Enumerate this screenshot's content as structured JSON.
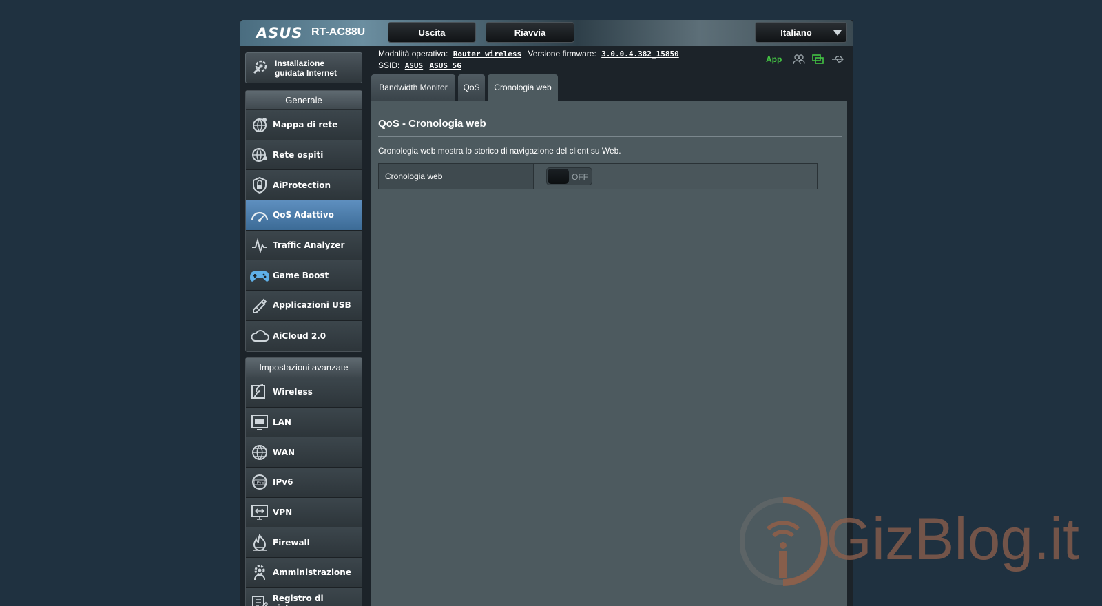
{
  "header": {
    "brand": "ASUS",
    "model": "RT-AC88U",
    "buttons": {
      "logout": "Uscita",
      "reboot": "Riavvia"
    },
    "language": "Italiano",
    "op_mode_label": "Modalità operativa:",
    "op_mode_value": "Router wireless",
    "fw_label": "Versione firmware:",
    "fw_value": "3.0.0.4.382_15850",
    "ssid_label": "SSID:",
    "ssid_1": "ASUS",
    "ssid_2": "ASUS_5G",
    "app_label": "App"
  },
  "sidebar": {
    "qis_label_1": "Installazione",
    "qis_label_2": "guidata Internet",
    "general_title": "Generale",
    "general_items": [
      {
        "label": "Mappa di rete",
        "icon": "network-map-icon"
      },
      {
        "label": "Rete ospiti",
        "icon": "guest-network-icon"
      },
      {
        "label": "AiProtection",
        "icon": "aiprotection-icon"
      },
      {
        "label": "QoS Adattivo",
        "icon": "qos-gauge-icon",
        "active": true
      },
      {
        "label": "Traffic Analyzer",
        "icon": "traffic-analyzer-icon"
      },
      {
        "label": "Game Boost",
        "icon": "gamepad-icon"
      },
      {
        "label": "Applicazioni USB",
        "icon": "usb-apps-icon"
      },
      {
        "label": "AiCloud 2.0",
        "icon": "cloud-icon"
      }
    ],
    "advanced_title": "Impostazioni avanzate",
    "advanced_items": [
      {
        "label": "Wireless",
        "icon": "wireless-icon"
      },
      {
        "label": "LAN",
        "icon": "lan-icon"
      },
      {
        "label": "WAN",
        "icon": "wan-globe-icon"
      },
      {
        "label": "IPv6",
        "icon": "ipv6-icon"
      },
      {
        "label": "VPN",
        "icon": "vpn-icon"
      },
      {
        "label": "Firewall",
        "icon": "firewall-icon"
      },
      {
        "label": "Amministrazione",
        "icon": "admin-gear-icon"
      },
      {
        "label": "Registro di sistema",
        "icon": "system-log-icon"
      }
    ]
  },
  "tabs": [
    {
      "label": "Bandwidth Monitor"
    },
    {
      "label": "QoS"
    },
    {
      "label": "Cronologia web",
      "active": true
    }
  ],
  "main": {
    "title": "QoS - Cronologia web",
    "description": "Cronologia web mostra lo storico di navigazione del client su Web.",
    "setting_label": "Cronologia web",
    "toggle_state": "OFF"
  },
  "watermark": {
    "text": "GizBlog.it"
  },
  "colors": {
    "accent_blue": "#4a7aa8",
    "status_green": "#43c443",
    "watermark": "#8c5f4b"
  }
}
